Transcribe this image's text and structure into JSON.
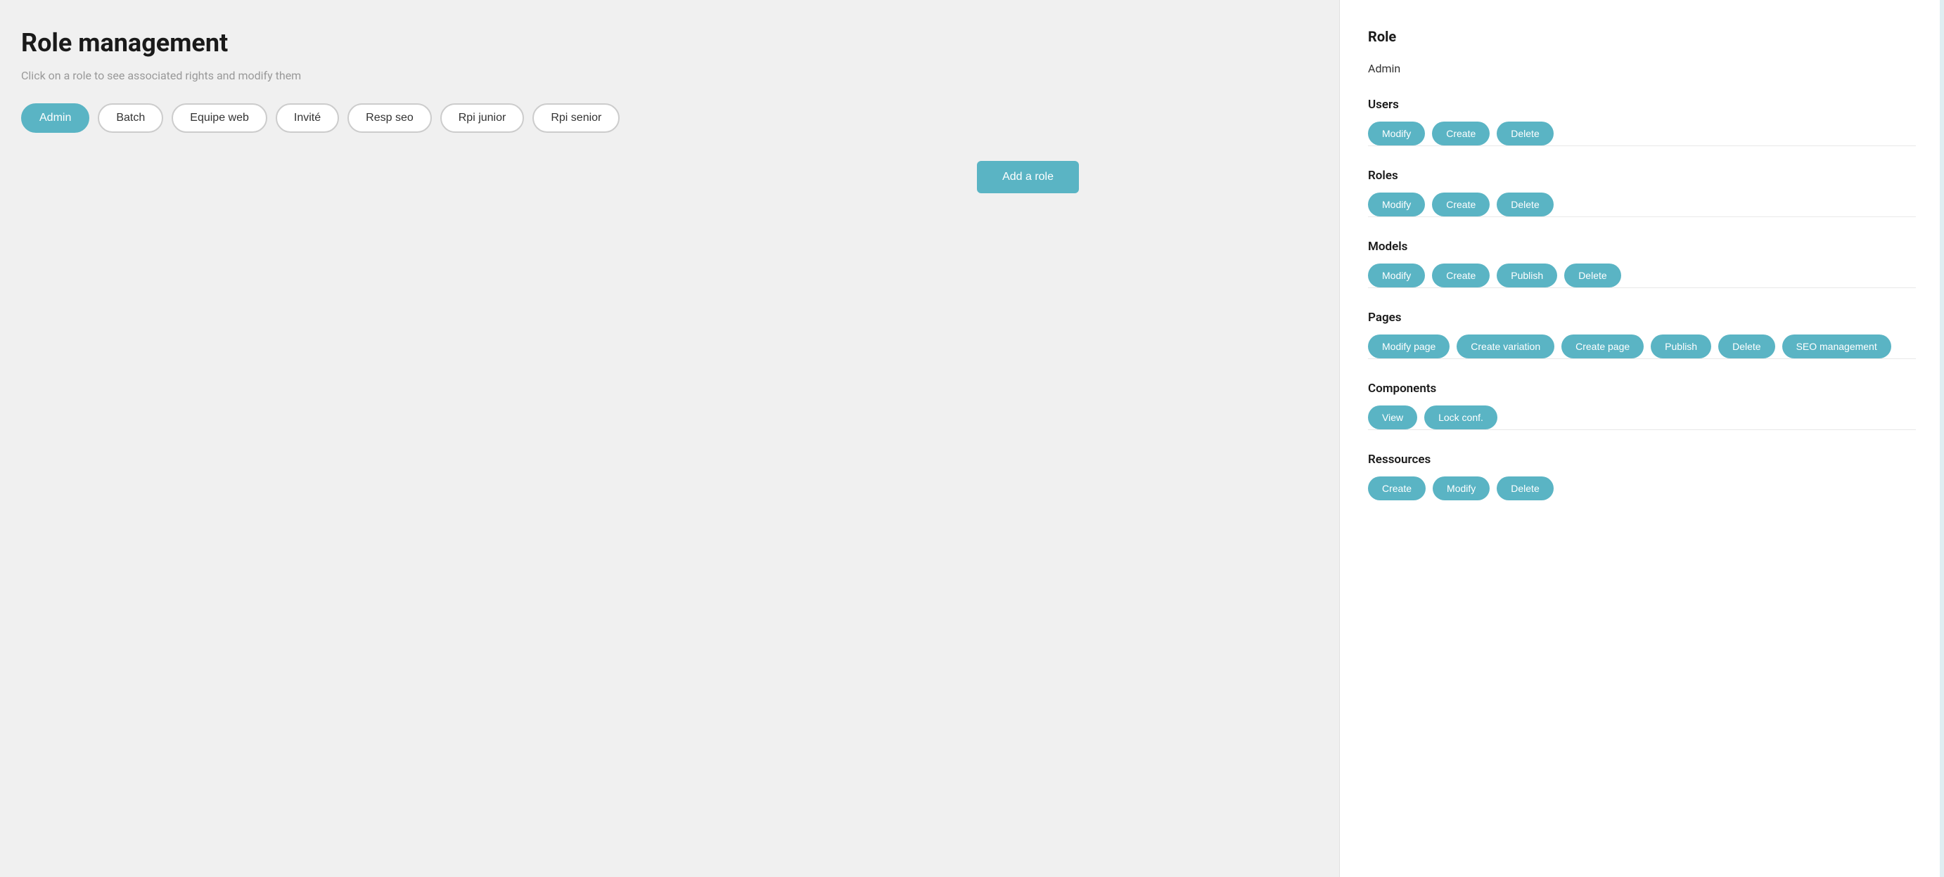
{
  "left": {
    "title": "Role management",
    "subtitle": "Click on a role to see associated rights and modify them",
    "roles": [
      {
        "id": "admin",
        "label": "Admin",
        "active": true
      },
      {
        "id": "batch",
        "label": "Batch",
        "active": false
      },
      {
        "id": "equipe-web",
        "label": "Equipe web",
        "active": false
      },
      {
        "id": "invite",
        "label": "Invité",
        "active": false
      },
      {
        "id": "resp-seo",
        "label": "Resp seo",
        "active": false
      },
      {
        "id": "rpi-junior",
        "label": "Rpi junior",
        "active": false
      },
      {
        "id": "rpi-senior",
        "label": "Rpi senior",
        "active": false
      }
    ],
    "add_role_label": "Add a role"
  },
  "right": {
    "panel_title": "Role",
    "role_name": "Admin",
    "sections": [
      {
        "id": "users",
        "title": "Users",
        "permissions": [
          "Modify",
          "Create",
          "Delete"
        ]
      },
      {
        "id": "roles",
        "title": "Roles",
        "permissions": [
          "Modify",
          "Create",
          "Delete"
        ]
      },
      {
        "id": "models",
        "title": "Models",
        "permissions": [
          "Modify",
          "Create",
          "Publish",
          "Delete"
        ]
      },
      {
        "id": "pages",
        "title": "Pages",
        "permissions": [
          "Modify page",
          "Create variation",
          "Create page",
          "Publish",
          "Delete",
          "SEO management"
        ]
      },
      {
        "id": "components",
        "title": "Components",
        "permissions": [
          "View",
          "Lock conf."
        ]
      },
      {
        "id": "ressources",
        "title": "Ressources",
        "permissions": [
          "Create",
          "Modify",
          "Delete"
        ]
      }
    ]
  }
}
